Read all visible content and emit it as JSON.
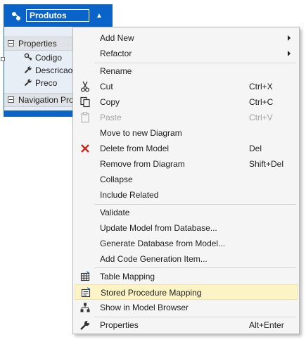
{
  "entity": {
    "title": "Produtos",
    "properties_label": "Properties",
    "properties": [
      "Codigo",
      "Descricao",
      "Preco"
    ],
    "navigation_label": "Navigation Pro"
  },
  "menu": {
    "items": [
      {
        "label": "Add New",
        "submenu": true
      },
      {
        "label": "Refactor",
        "submenu": true
      },
      {
        "label": "Rename"
      },
      {
        "label": "Cut",
        "shortcut": "Ctrl+X",
        "icon": "scissors-icon"
      },
      {
        "label": "Copy",
        "shortcut": "Ctrl+C",
        "icon": "copy-icon"
      },
      {
        "label": "Paste",
        "shortcut": "Ctrl+V",
        "icon": "paste-icon",
        "disabled": true
      },
      {
        "label": "Move to new Diagram"
      },
      {
        "label": "Delete from Model",
        "shortcut": "Del",
        "icon": "delete-x-icon"
      },
      {
        "label": "Remove from Diagram",
        "shortcut": "Shift+Del"
      },
      {
        "label": "Collapse"
      },
      {
        "label": "Include Related"
      },
      {
        "label": "Validate"
      },
      {
        "label": "Update Model from Database..."
      },
      {
        "label": "Generate Database from Model..."
      },
      {
        "label": "Add Code Generation Item..."
      },
      {
        "label": "Table Mapping",
        "icon": "table-mapping-icon"
      },
      {
        "label": "Stored Procedure Mapping",
        "icon": "stored-procedure-icon",
        "highlighted": true
      },
      {
        "label": "Show in Model Browser",
        "icon": "model-browser-icon"
      },
      {
        "label": "Properties",
        "shortcut": "Alt+Enter",
        "icon": "wrench-icon"
      }
    ]
  },
  "colors": {
    "header_blue": "#0a63c9",
    "menu_background": "#f5f5f5",
    "highlight": "#fcf4c6",
    "delete_red": "#c8281c"
  }
}
